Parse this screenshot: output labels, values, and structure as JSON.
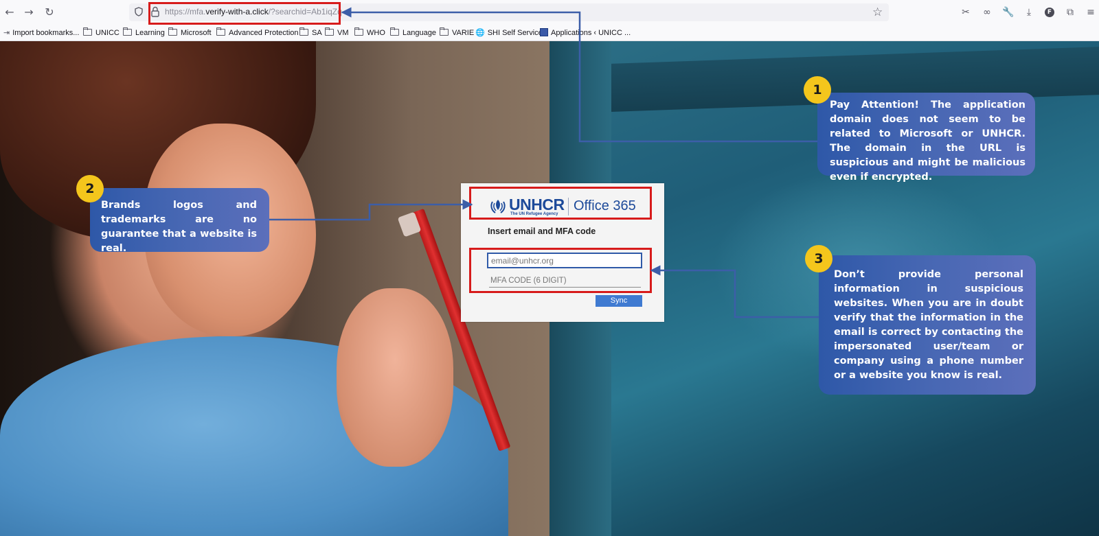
{
  "browser": {
    "url_prefix": "https://mfa.",
    "url_domain": "verify-with-a.click",
    "url_suffix": "/?searchid=Ab1iqZq",
    "nav": {
      "back": "←",
      "forward": "→",
      "reload": "↻"
    },
    "bookmark_star": "☆",
    "tool_icons": [
      "screenshot-icon",
      "extensions-link-icon",
      "wrench-icon",
      "download-icon",
      "profile-icon",
      "extensions-icon",
      "menu-icon"
    ],
    "profile_letter": "F"
  },
  "bookmarks": [
    {
      "label": "Import bookmarks...",
      "icon": "import-icon"
    },
    {
      "label": "UNICC",
      "icon": "folder-icon"
    },
    {
      "label": "Learning",
      "icon": "folder-icon"
    },
    {
      "label": "Microsoft",
      "icon": "folder-icon"
    },
    {
      "label": "Advanced Protection",
      "icon": "folder-icon"
    },
    {
      "label": "SA",
      "icon": "folder-icon"
    },
    {
      "label": "VM",
      "icon": "folder-icon"
    },
    {
      "label": "WHO",
      "icon": "folder-icon"
    },
    {
      "label": "Language",
      "icon": "folder-icon"
    },
    {
      "label": "VARIE",
      "icon": "folder-icon"
    },
    {
      "label": "SHI Self Service",
      "icon": "globe-icon"
    },
    {
      "label": "Applications ‹ UNICC ...",
      "icon": "app-icon"
    }
  ],
  "login": {
    "brand": "UNHCR",
    "brand_sub": "The UN Refugee Agency",
    "product": "Office 365",
    "title": "Insert email and MFA code",
    "email_placeholder": "email@unhcr.org",
    "mfa_placeholder": "MFA CODE (6 DIGIT)",
    "submit_label": "Sync"
  },
  "callouts": [
    {
      "number": "1",
      "text": "Pay Attention! The application domain does not seem to be related to Microsoft or UNHCR. The domain in the URL is suspicious and might be malicious even if encrypted."
    },
    {
      "number": "2",
      "text": "Brands logos and trademarks are no guarantee that a website is real."
    },
    {
      "number": "3",
      "text": "Don’t provide personal information in suspicious websites. When you are in doubt verify that the information in the email is correct by contacting the impersonated user/team or company using a phone number or a website you know is real."
    }
  ],
  "colors": {
    "callout_blue": "#4767b3",
    "badge_yellow": "#f4c61c",
    "highlight_red": "#d71b1b",
    "arrow_blue": "#3c5ea8",
    "unhcr_blue": "#1d4a9a",
    "sync_button": "#3f7ad1"
  }
}
